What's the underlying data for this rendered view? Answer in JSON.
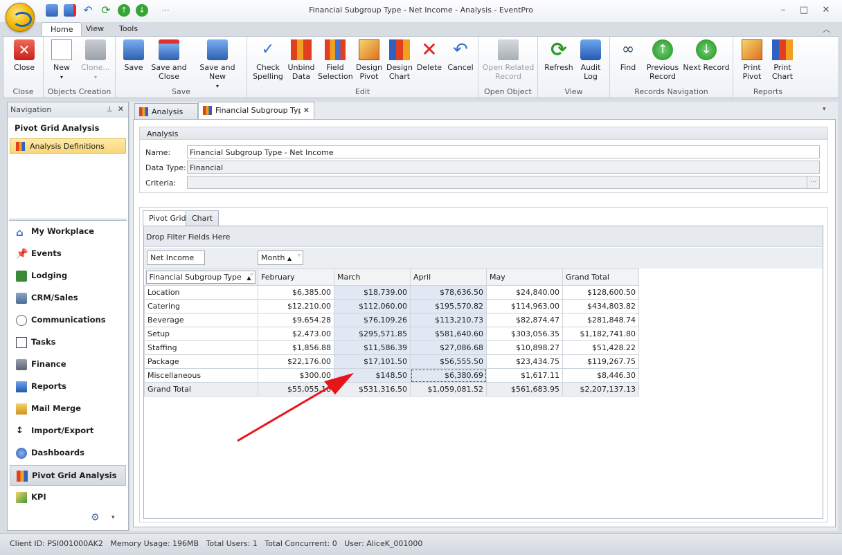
{
  "window": {
    "title": "Financial Subgroup Type - Net Income - Analysis - EventPro"
  },
  "ribbon_tabs": [
    "Home",
    "View",
    "Tools"
  ],
  "ribbon": {
    "close": {
      "btn": "Close",
      "group": "Close"
    },
    "objects": {
      "new": "New",
      "clone": "Clone...",
      "group": "Objects Creation"
    },
    "save": {
      "save": "Save",
      "save_close_1": "Save and",
      "save_close_2": "Close",
      "save_new": "Save and New",
      "group": "Save"
    },
    "edit": {
      "check_1": "Check",
      "check_2": "Spelling",
      "unbind_1": "Unbind",
      "unbind_2": "Data",
      "field_1": "Field",
      "field_2": "Selection",
      "dpivot_1": "Design",
      "dpivot_2": "Pivot",
      "dchart_1": "Design",
      "dchart_2": "Chart",
      "delete": "Delete",
      "cancel": "Cancel",
      "group": "Edit"
    },
    "open": {
      "btn_1": "Open Related",
      "btn_2": "Record",
      "group": "Open Object"
    },
    "view": {
      "refresh": "Refresh",
      "audit_1": "Audit",
      "audit_2": "Log",
      "group": "View"
    },
    "records": {
      "find": "Find",
      "prev_1": "Previous",
      "prev_2": "Record",
      "next": "Next Record",
      "group": "Records Navigation"
    },
    "reports": {
      "pp_1": "Print",
      "pp_2": "Pivot",
      "pc_1": "Print",
      "pc_2": "Chart",
      "group": "Reports"
    }
  },
  "nav": {
    "header": "Navigation",
    "section": "Pivot Grid Analysis",
    "selected_item": "Analysis Definitions",
    "items": [
      "My Workplace",
      "Events",
      "Lodging",
      "CRM/Sales",
      "Communications",
      "Tasks",
      "Finance",
      "Reports",
      "Mail Merge",
      "Import/Export",
      "Dashboards",
      "Pivot Grid Analysis",
      "KPI"
    ]
  },
  "doc_tabs": [
    "Analysis",
    "Financial Subgroup Type"
  ],
  "analysis": {
    "group_title": "Analysis",
    "name_label": "Name:",
    "name_value": "Financial Subgroup Type - Net Income",
    "type_label": "Data Type:",
    "type_value": "Financial",
    "criteria_label": "Criteria:",
    "criteria_btn": "..."
  },
  "pivot": {
    "tabs": [
      "Pivot Grid",
      "Chart"
    ],
    "filter_text": "Drop Filter Fields Here",
    "data_field": "Net Income",
    "column_field": "Month",
    "row_field": "Financial Subgroup Type",
    "columns": [
      "February",
      "March",
      "April",
      "May",
      "Grand Total"
    ],
    "rows": [
      {
        "label": "Location",
        "values": [
          "$6,385.00",
          "$18,739.00",
          "$78,636.50",
          "$24,840.00",
          "$128,600.50"
        ]
      },
      {
        "label": "Catering",
        "values": [
          "$12,210.00",
          "$112,060.00",
          "$195,570.82",
          "$114,963.00",
          "$434,803.82"
        ]
      },
      {
        "label": "Beverage",
        "values": [
          "$9,654.28",
          "$76,109.26",
          "$113,210.73",
          "$82,874.47",
          "$281,848.74"
        ]
      },
      {
        "label": "Setup",
        "values": [
          "$2,473.00",
          "$295,571.85",
          "$581,640.60",
          "$303,056.35",
          "$1,182,741.80"
        ]
      },
      {
        "label": "Staffing",
        "values": [
          "$1,856.88",
          "$11,586.39",
          "$27,086.68",
          "$10,898.27",
          "$51,428.22"
        ]
      },
      {
        "label": "Package",
        "values": [
          "$22,176.00",
          "$17,101.50",
          "$56,555.50",
          "$23,434.75",
          "$119,267.75"
        ]
      },
      {
        "label": "Miscellaneous",
        "values": [
          "$300.00",
          "$148.50",
          "$6,380.69",
          "$1,617.11",
          "$8,446.30"
        ]
      },
      {
        "label": "Grand Total",
        "values": [
          "$55,055.16",
          "$531,316.50",
          "$1,059,081.52",
          "$561,683.95",
          "$2,207,137.13"
        ]
      }
    ]
  },
  "status": {
    "text": "Client ID: PSI001000AK2   Memory Usage: 196MB   Total Users: 1   Total Concurrent: 0   User: AliceK_001000"
  },
  "colors": {
    "accent": "#f7d872",
    "arrow": "#e8141b",
    "highlight": "#dfe8f3"
  }
}
